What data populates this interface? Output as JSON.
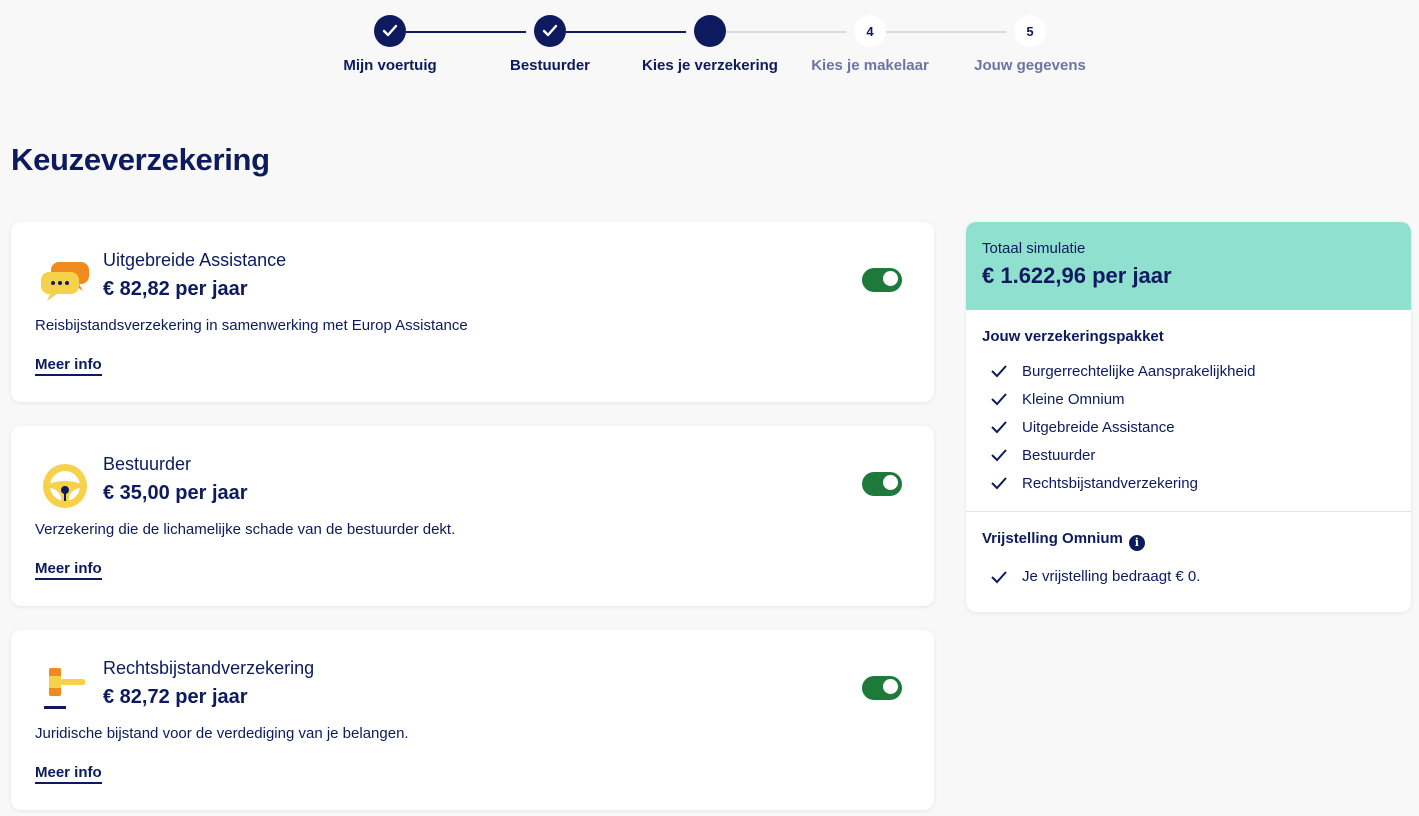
{
  "stepper": {
    "steps": [
      {
        "label": "Mijn voertuig",
        "state": "done",
        "number": ""
      },
      {
        "label": "Bestuurder",
        "state": "done",
        "number": ""
      },
      {
        "label": "Kies je verzekering",
        "state": "active",
        "number": ""
      },
      {
        "label": "Kies je makelaar",
        "state": "todo",
        "number": "4"
      },
      {
        "label": "Jouw gegevens",
        "state": "todo",
        "number": "5"
      }
    ]
  },
  "page": {
    "title": "Keuzeverzekering"
  },
  "options": [
    {
      "icon": "chat-bubbles-icon",
      "name": "Uitgebreide Assistance",
      "price": "€ 82,82 per jaar",
      "description": "Reisbijstandsverzekering in samenwerking met Europ Assistance",
      "more_label": "Meer info",
      "enabled": true
    },
    {
      "icon": "steering-wheel-icon",
      "name": "Bestuurder",
      "price": "€ 35,00 per jaar",
      "description": "Verzekering die de lichamelijke schade van de bestuurder dekt.",
      "more_label": "Meer info",
      "enabled": true
    },
    {
      "icon": "gavel-icon",
      "name": "Rechtsbijstandverzekering",
      "price": "€ 82,72 per jaar",
      "description": "Juridische bijstand voor de verdediging van je belangen.",
      "more_label": "Meer info",
      "enabled": true
    }
  ],
  "summary": {
    "total_label": "Totaal simulatie",
    "total_value": "€ 1.622,96 per jaar",
    "package_title": "Jouw verzekeringspakket",
    "package_items": [
      "Burgerrechtelijke Aansprakelijkheid",
      "Kleine Omnium",
      "Uitgebreide Assistance",
      "Bestuurder",
      "Rechtsbijstandverzekering"
    ],
    "deductible_title": "Vrijstelling Omnium",
    "deductible_info_icon": "i",
    "deductible_items": [
      "Je vrijstelling bedraagt € 0."
    ]
  },
  "colors": {
    "navy": "#0d1b5e",
    "toggle_on": "#1e7a3a",
    "summary_header": "#8fe0cf",
    "muted_step": "#6b74a6"
  }
}
